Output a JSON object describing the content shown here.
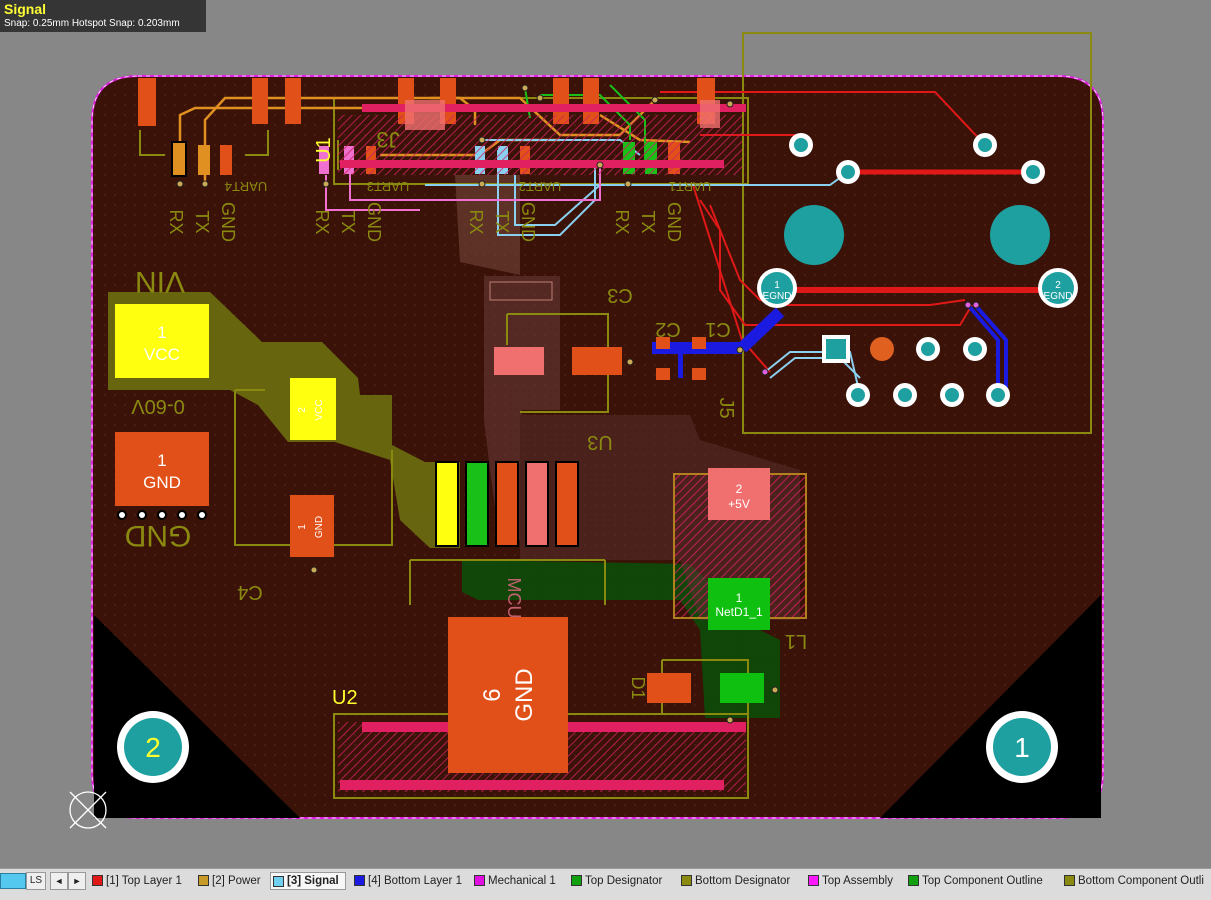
{
  "hud": {
    "title": "Signal",
    "snap": "Snap: 0.25mm Hotspot Snap: 0.203mm"
  },
  "board": {
    "designators": [
      "J3",
      "U1",
      "C3",
      "C1",
      "C2",
      "J5",
      "U3",
      "C4",
      "U2",
      "D1",
      "L1",
      "MCU"
    ],
    "silk": {
      "rx": "RX",
      "tx": "TX",
      "gnd": "GND",
      "vin": "VIN",
      "range": "0-60V",
      "uart1": "UART1",
      "uart2": "UART2",
      "uart3": "UART3",
      "uart4": "UART4"
    },
    "pads": {
      "vcc1_num": "1",
      "vcc1_net": "VCC",
      "vcc2_num": "2",
      "vcc2_net": "VCC",
      "gnd1_num": "1",
      "gnd1_net": "GND",
      "gnd2_num": "1",
      "gnd2_net": "GND",
      "v5_num": "2",
      "v5_net": "+5V",
      "netd1_num": "1",
      "netd1_net": "NetD1_1",
      "egnd1_num": "1",
      "egnd1_net": "EGND",
      "egnd2_num": "2",
      "egnd2_net": "EGND",
      "mcu_num": "6",
      "mcu_net": "GND",
      "mh1": "1",
      "mh2": "2"
    }
  },
  "layers": {
    "ls": "LS",
    "prev": "◄",
    "next": "►",
    "tabs": [
      {
        "label": "[1] Top Layer 1",
        "color": "#e01818"
      },
      {
        "label": "[2] Power",
        "color": "#c89a28"
      },
      {
        "label": "[3] Signal",
        "color": "#70d0f0",
        "active": true
      },
      {
        "label": "[4] Bottom Layer 1",
        "color": "#1a1ae0"
      },
      {
        "label": "Mechanical 1",
        "color": "#e010e0"
      },
      {
        "label": "Top Designator",
        "color": "#10a010"
      },
      {
        "label": "Bottom Designator",
        "color": "#8a8a10"
      },
      {
        "label": "Top Assembly",
        "color": "#ff18ff"
      },
      {
        "label": "Top Component Outline",
        "color": "#10a010"
      },
      {
        "label": "Bottom Component Outli",
        "color": "#8a8a10"
      }
    ]
  }
}
